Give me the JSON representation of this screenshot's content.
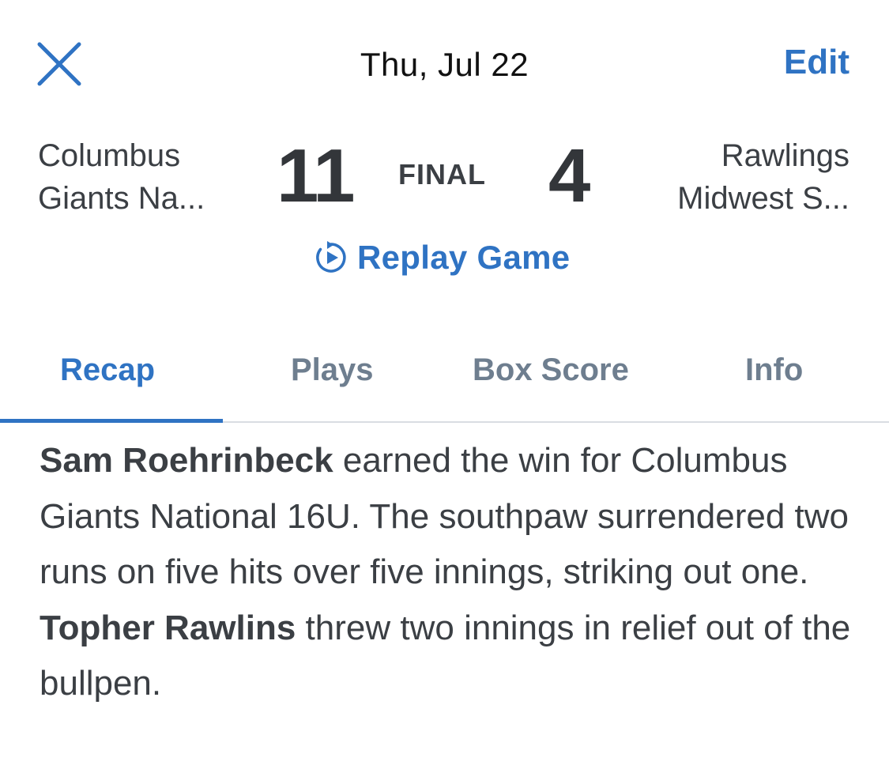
{
  "header": {
    "date": "Thu, Jul 22",
    "edit_label": "Edit",
    "close_icon": "close-icon",
    "accent_color": "#2f73c3"
  },
  "game": {
    "home_team_line1": "Columbus",
    "home_team_line2": "Giants  Na...",
    "home_score": "11",
    "status": "FINAL",
    "away_score": "4",
    "away_team_line1": "Rawlings",
    "away_team_line2": "Midwest S..."
  },
  "replay": {
    "icon": "replay-icon",
    "label": "Replay Game"
  },
  "tabs": [
    {
      "label": "Recap",
      "active": true
    },
    {
      "label": "Plays",
      "active": false
    },
    {
      "label": "Box Score",
      "active": false
    },
    {
      "label": "Info",
      "active": false
    }
  ],
  "recap": {
    "pitcher1": "Sam Roehrinbeck",
    "text1": " earned the win for Columbus Giants  National 16U. The southpaw surrendered two runs on five hits over five innings, striking out one.  ",
    "pitcher2": "Topher Rawlins",
    "text2": " threw two innings in relief out of the bullpen."
  }
}
